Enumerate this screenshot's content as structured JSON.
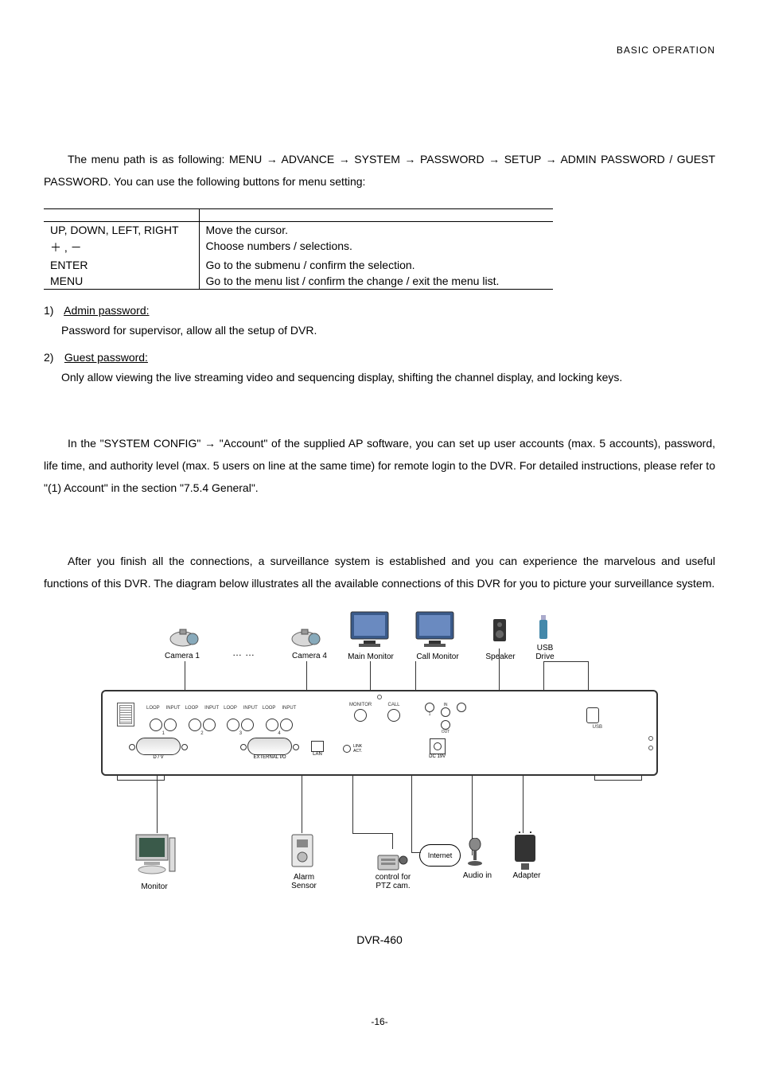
{
  "header": "BASIC  OPERATION",
  "intro": "The menu path is as following: MENU → ADVANCE → SYSTEM → PASSWORD → SETUP → ADMIN PASSWORD / GUEST PASSWORD. You can use the following buttons for menu setting:",
  "buttons_table": [
    {
      "key": "UP, DOWN, LEFT, RIGHT",
      "desc": "Move the cursor."
    },
    {
      "key": "＋ ,  －",
      "desc": "Choose numbers / selections."
    },
    {
      "key": "ENTER",
      "desc": "Go to the submenu / confirm the selection."
    },
    {
      "key": "MENU",
      "desc": "Go to the menu list / confirm the change / exit the menu list."
    }
  ],
  "items": [
    {
      "num": "1)",
      "title": "Admin password:",
      "body": "Password for supervisor, allow all the setup of DVR."
    },
    {
      "num": "2)",
      "title": "Guest password:",
      "body": "Only allow viewing the live streaming video and sequencing display, shifting the channel display, and locking keys."
    }
  ],
  "account_para": "In the \"SYSTEM CONFIG\" → \"Account\" of the supplied AP software, you can set up user accounts (max. 5 accounts), password, life time, and authority level (max. 5 users on line at the same time) for remote login to the DVR. For detailed instructions, please refer to \"(1) Account\" in the section \"7.5.4 General\".",
  "connections_para": "After you finish all the connections, a surveillance system is established and you can experience the marvelous and useful functions of this DVR. The diagram below illustrates all the available connections of this DVR for you to picture your surveillance system.",
  "diagram": {
    "model": "DVR-460",
    "top_labels": {
      "camera1": "Camera 1",
      "camera4": "Camera  4",
      "between": "……",
      "main_monitor": "Main Monitor",
      "call_monitor": "Call Monitor",
      "speaker": "Speaker",
      "usb_drive": "USB\nDrive"
    },
    "backpanel": {
      "bnc_loop": "LOOP",
      "bnc_input": "INPUT",
      "bnc_nums": [
        "1",
        "2",
        "3",
        "4"
      ],
      "monitor": "MONITOR",
      "call": "CALL",
      "audio_in": "IN",
      "audio_out": "OUT",
      "usb": "USB",
      "dv": "D / V",
      "ext_io": "EXTERNAL I/O",
      "lan": "LAN",
      "link_act": "LINK\nACT.",
      "dc": "DC 19V"
    },
    "bottom_labels": {
      "monitor": "Monitor",
      "alarm_sensor": "Alarm\nSensor",
      "ptz": "control for\nPTZ cam.",
      "internet": "Internet",
      "audio_in": "Audio in",
      "adapter": "Adapter"
    }
  },
  "page_num": "-16-"
}
